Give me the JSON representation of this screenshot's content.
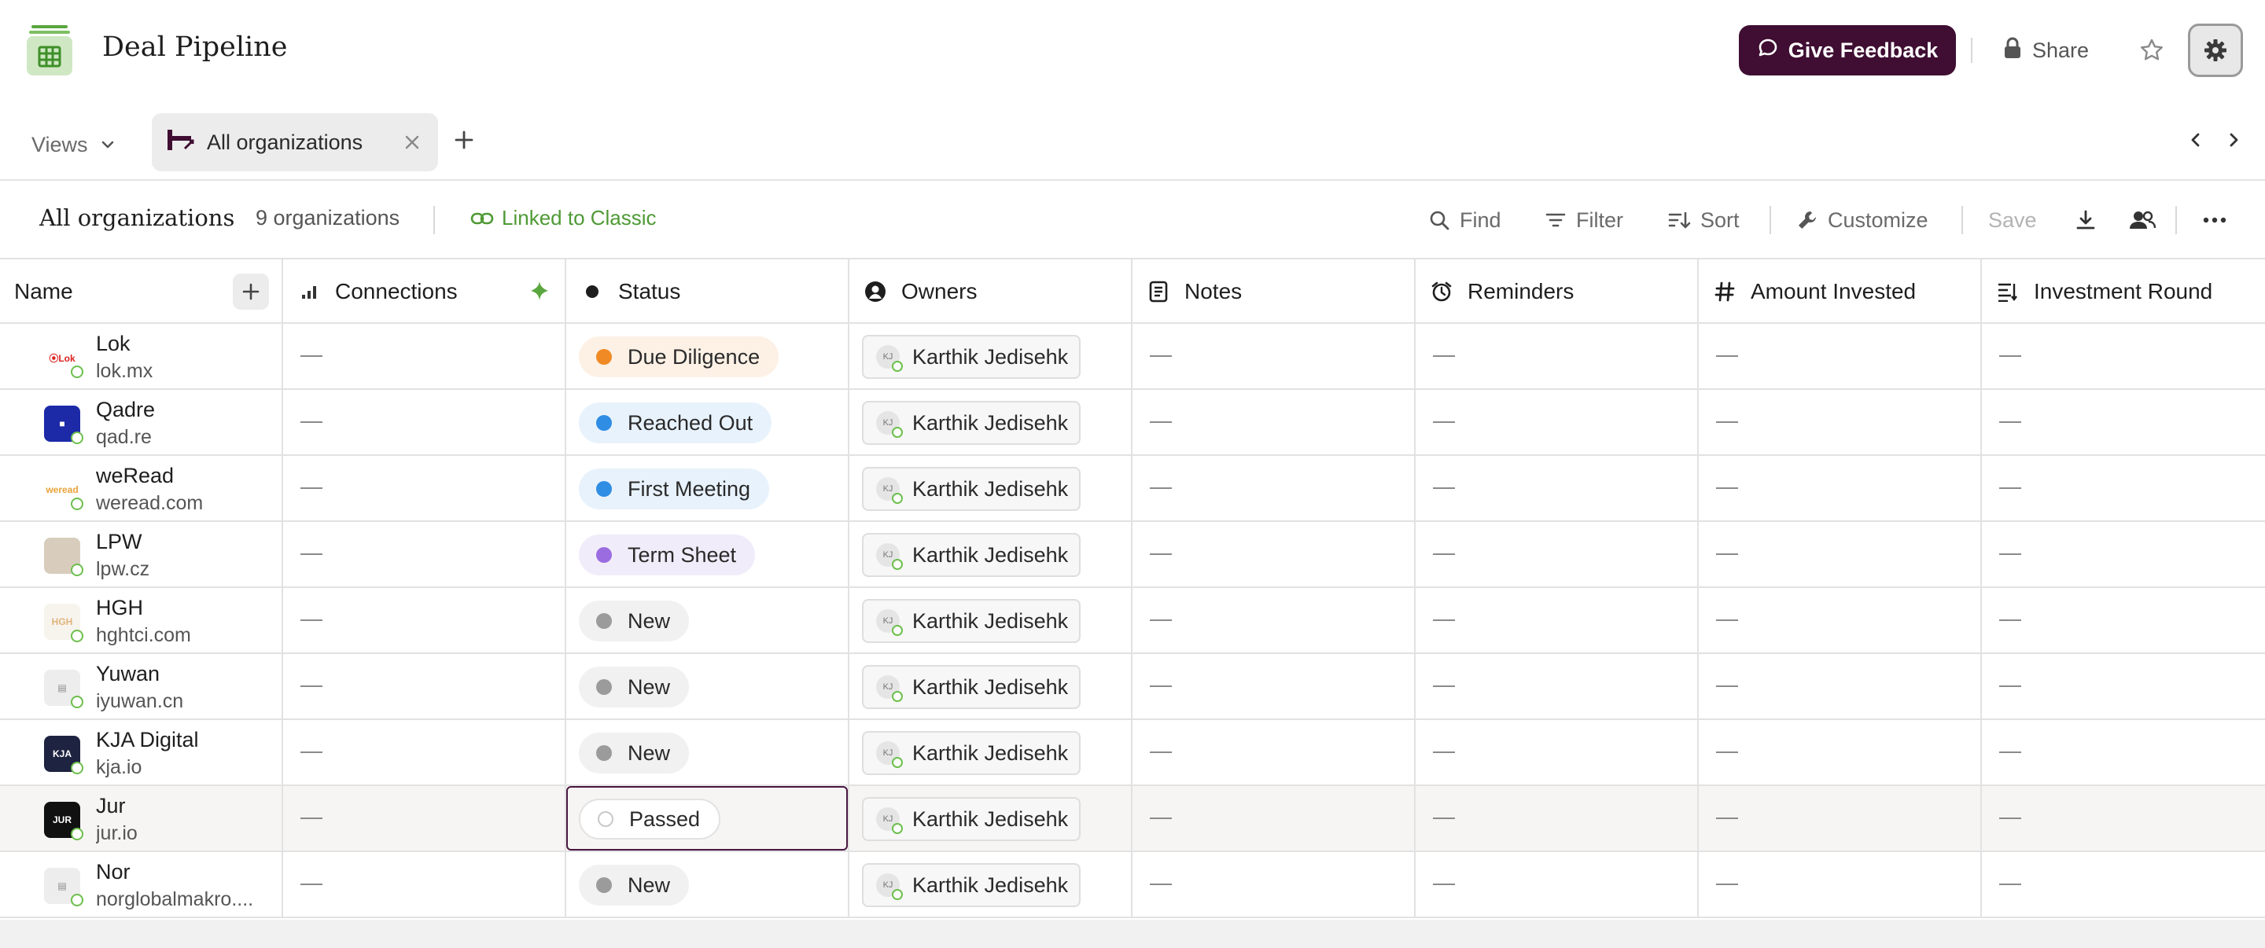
{
  "header": {
    "title": "Deal Pipeline",
    "feedback_label": "Give Feedback",
    "share_label": "Share"
  },
  "tabs": {
    "views_label": "Views",
    "active_tab_label": "All organizations"
  },
  "view": {
    "title": "All organizations",
    "count": "9 organizations",
    "linked_label": "Linked to Classic",
    "toolbar": {
      "find": "Find",
      "filter": "Filter",
      "sort": "Sort",
      "customize": "Customize",
      "save": "Save"
    }
  },
  "columns": [
    {
      "label": "Name",
      "icon": "none"
    },
    {
      "label": "Connections",
      "icon": "signal-bars-icon"
    },
    {
      "label": "Status",
      "icon": "status-dot-icon"
    },
    {
      "label": "Owners",
      "icon": "user-circle-icon"
    },
    {
      "label": "Notes",
      "icon": "document-icon"
    },
    {
      "label": "Reminders",
      "icon": "alarm-clock-icon"
    },
    {
      "label": "Amount Invested",
      "icon": "hash-icon"
    },
    {
      "label": "Investment Round",
      "icon": "list-options-icon"
    }
  ],
  "status_colors": {
    "Due Diligence": {
      "dot": "#f08a24",
      "bg": "#fdf1e6"
    },
    "Reached Out": {
      "dot": "#2f8de4",
      "bg": "#e8f2fc"
    },
    "First Meeting": {
      "dot": "#2f8de4",
      "bg": "#e8f2fc"
    },
    "Term Sheet": {
      "dot": "#9b6ce0",
      "bg": "#f1ecfa"
    },
    "New": {
      "dot": "#9b9b9b",
      "bg": "#f1f1f1"
    },
    "Passed": {
      "dot": "#ffffff",
      "bg": "#ffffff"
    }
  },
  "rows": [
    {
      "name": "Lok",
      "domain": "lok.mx",
      "status": "Due Diligence",
      "owner": "Karthik Jedisehk",
      "owner_initials": "KJ",
      "logo": {
        "text": "⦿Lok",
        "bg": "#ffffff",
        "fg": "#d22"
      }
    },
    {
      "name": "Qadre",
      "domain": "qad.re",
      "status": "Reached Out",
      "owner": "Karthik Jedisehk",
      "owner_initials": "KJ",
      "logo": {
        "text": "■",
        "bg": "#1c2aa8",
        "fg": "#ffffff"
      }
    },
    {
      "name": "weRead",
      "domain": "weread.com",
      "status": "First Meeting",
      "owner": "Karthik Jedisehk",
      "owner_initials": "KJ",
      "logo": {
        "text": "weread",
        "bg": "#ffffff",
        "fg": "#e8a23a"
      }
    },
    {
      "name": "LPW",
      "domain": "lpw.cz",
      "status": "Term Sheet",
      "owner": "Karthik Jedisehk",
      "owner_initials": "KJ",
      "logo": {
        "text": "",
        "bg": "#d8cdbd",
        "fg": "#555"
      }
    },
    {
      "name": "HGH",
      "domain": "hghtci.com",
      "status": "New",
      "owner": "Karthik Jedisehk",
      "owner_initials": "KJ",
      "logo": {
        "text": "HGH",
        "bg": "#f7f4ee",
        "fg": "#e1b47a"
      }
    },
    {
      "name": "Yuwan",
      "domain": "iyuwan.cn",
      "status": "New",
      "owner": "Karthik Jedisehk",
      "owner_initials": "KJ",
      "logo": {
        "text": "▤",
        "bg": "#ededed",
        "fg": "#8a8a8a"
      }
    },
    {
      "name": "KJA Digital",
      "domain": "kja.io",
      "status": "New",
      "owner": "Karthik Jedisehk",
      "owner_initials": "KJ",
      "logo": {
        "text": "KJA",
        "bg": "#1d2340",
        "fg": "#ffffff"
      }
    },
    {
      "name": "Jur",
      "domain": "jur.io",
      "status": "Passed",
      "owner": "Karthik Jedisehk",
      "owner_initials": "KJ",
      "logo": {
        "text": "JUR",
        "bg": "#111111",
        "fg": "#ffffff"
      },
      "selected": true
    },
    {
      "name": "Nor",
      "domain": "norglobalmakro....",
      "status": "New",
      "owner": "Karthik Jedisehk",
      "owner_initials": "KJ",
      "logo": {
        "text": "▤",
        "bg": "#ededed",
        "fg": "#8a8a8a"
      }
    }
  ],
  "empty_value": "—",
  "colors": {
    "brand_dark": "#3f0e32",
    "link_green": "#4e9a35",
    "grid_line": "#e2e2e2"
  }
}
